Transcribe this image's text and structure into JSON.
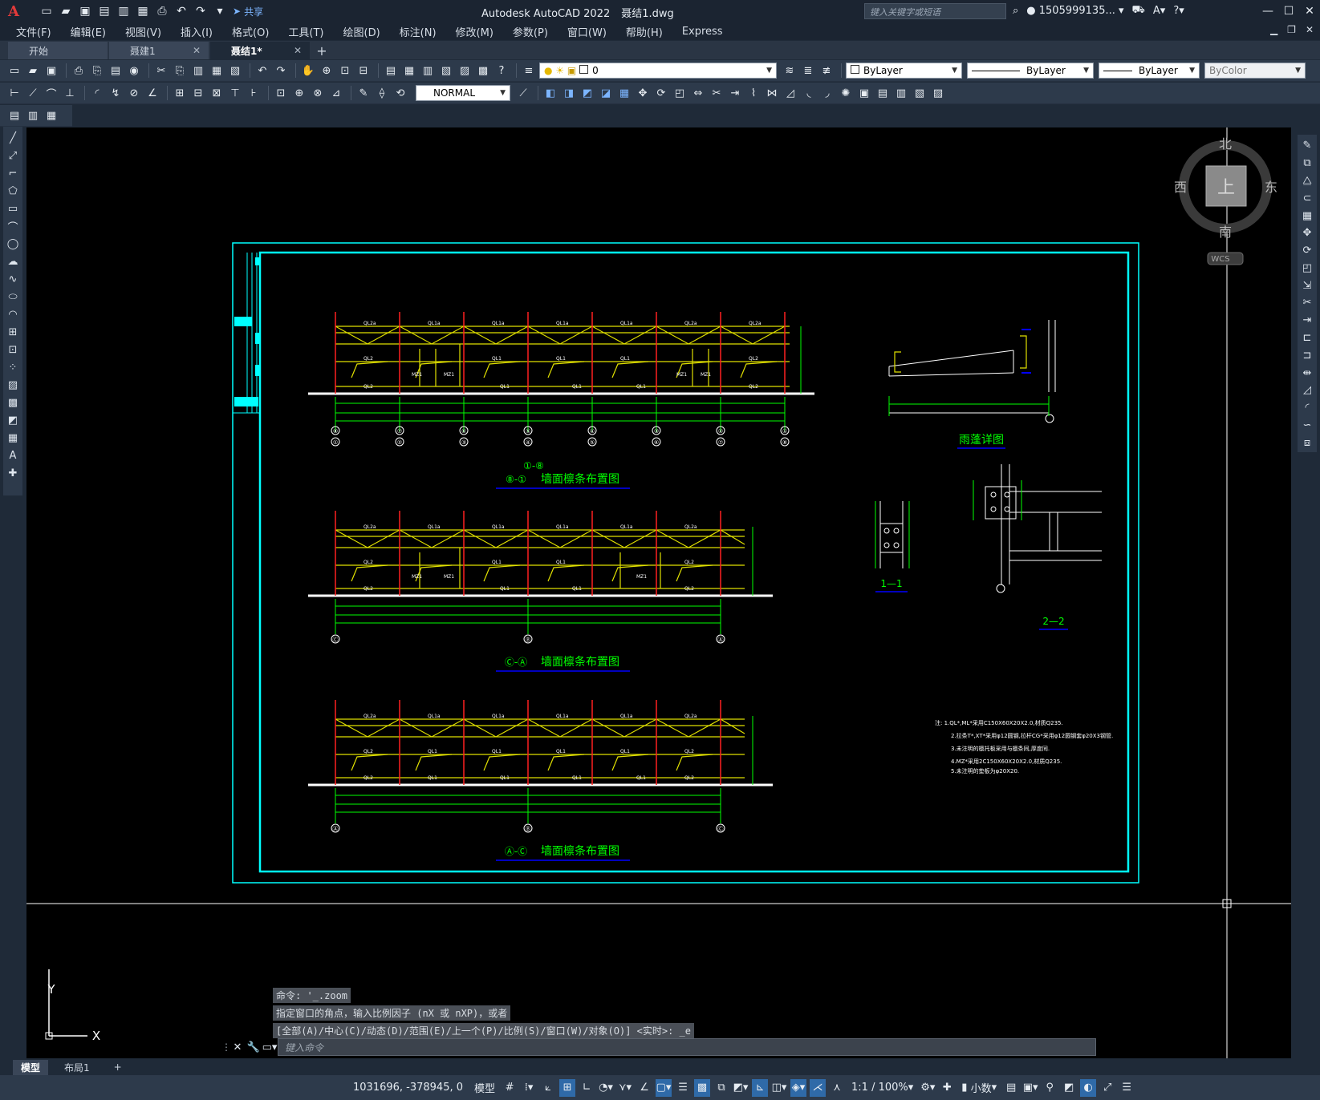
{
  "app": {
    "logo_text": "A",
    "title": "Autodesk AutoCAD 2022",
    "file": "聂结1.dwg",
    "share_label": "共享",
    "search_placeholder": "键入关键字或短语",
    "user_name": "1505999135..."
  },
  "menus": [
    "文件(F)",
    "编辑(E)",
    "视图(V)",
    "插入(I)",
    "格式(O)",
    "工具(T)",
    "绘图(D)",
    "标注(N)",
    "修改(M)",
    "参数(P)",
    "窗口(W)",
    "帮助(H)",
    "Express"
  ],
  "tabs": [
    {
      "label": "开始"
    },
    {
      "label": "聂建1"
    },
    {
      "label": "聂结1*"
    }
  ],
  "properties": {
    "layer": "0",
    "dimstyle": "NORMAL",
    "color": "ByLayer",
    "linetype": "ByLayer",
    "lineweight": "ByLayer",
    "plotstyle": "ByColor"
  },
  "viewcube": {
    "north": "北",
    "south": "南",
    "east": "东",
    "west": "西",
    "face": "上",
    "wcs": "WCS"
  },
  "drawing": {
    "title1_circles": "①-⑧",
    "title1_circles2": "⑧-①",
    "title1": "墙面檩条布置图",
    "title2_circles": "Ⓒ-Ⓐ",
    "title2": "墙面檩条布置图",
    "title3_circles": "Ⓐ-Ⓒ",
    "title3": "墙面檩条布置图",
    "detail_rain": "雨蓬详图",
    "section_1": "1—1",
    "section_2": "2—2",
    "notes": [
      "注: 1.QL*,ML*采用C150X60X20X2.0,材质Q235.",
      "2.拉条T*,XT*采用φ12圆钢,拉杆CG*采用φ12圆钢套φ20X3钢管.",
      "3.未注明的檩托板采用与檩条同,厚度同.",
      "4.MZ*采用2C150X60X20X2.0,材质Q235.",
      "5.未注明的垫板为φ20X20."
    ],
    "axes_top": [
      "①",
      "②",
      "③",
      "④",
      "⑤",
      "⑥",
      "⑦",
      "⑧"
    ],
    "axes_top_upper": [
      "⑧",
      "⑦",
      "⑥",
      "⑤",
      "④",
      "③",
      "②",
      "①"
    ],
    "axes_mid": [
      "Ⓒ",
      "Ⓑ",
      "Ⓐ"
    ],
    "axes_bot": [
      "Ⓐ",
      "Ⓑ",
      "Ⓒ"
    ],
    "ucs_x": "X",
    "ucs_y": "Y"
  },
  "command": {
    "history": [
      "命令: '_.zoom",
      "指定窗口的角点，输入比例因子 (nX 或 nXP)，或者",
      "[全部(A)/中心(C)/动态(D)/范围(E)/上一个(P)/比例(S)/窗口(W)/对象(O)] <实时>: _e"
    ],
    "placeholder": "键入命令"
  },
  "layouts": [
    "模型",
    "布局1"
  ],
  "status": {
    "coords": "1031696, -378945, 0",
    "model": "模型",
    "scale": "1:1 / 100%",
    "units": "小数"
  }
}
